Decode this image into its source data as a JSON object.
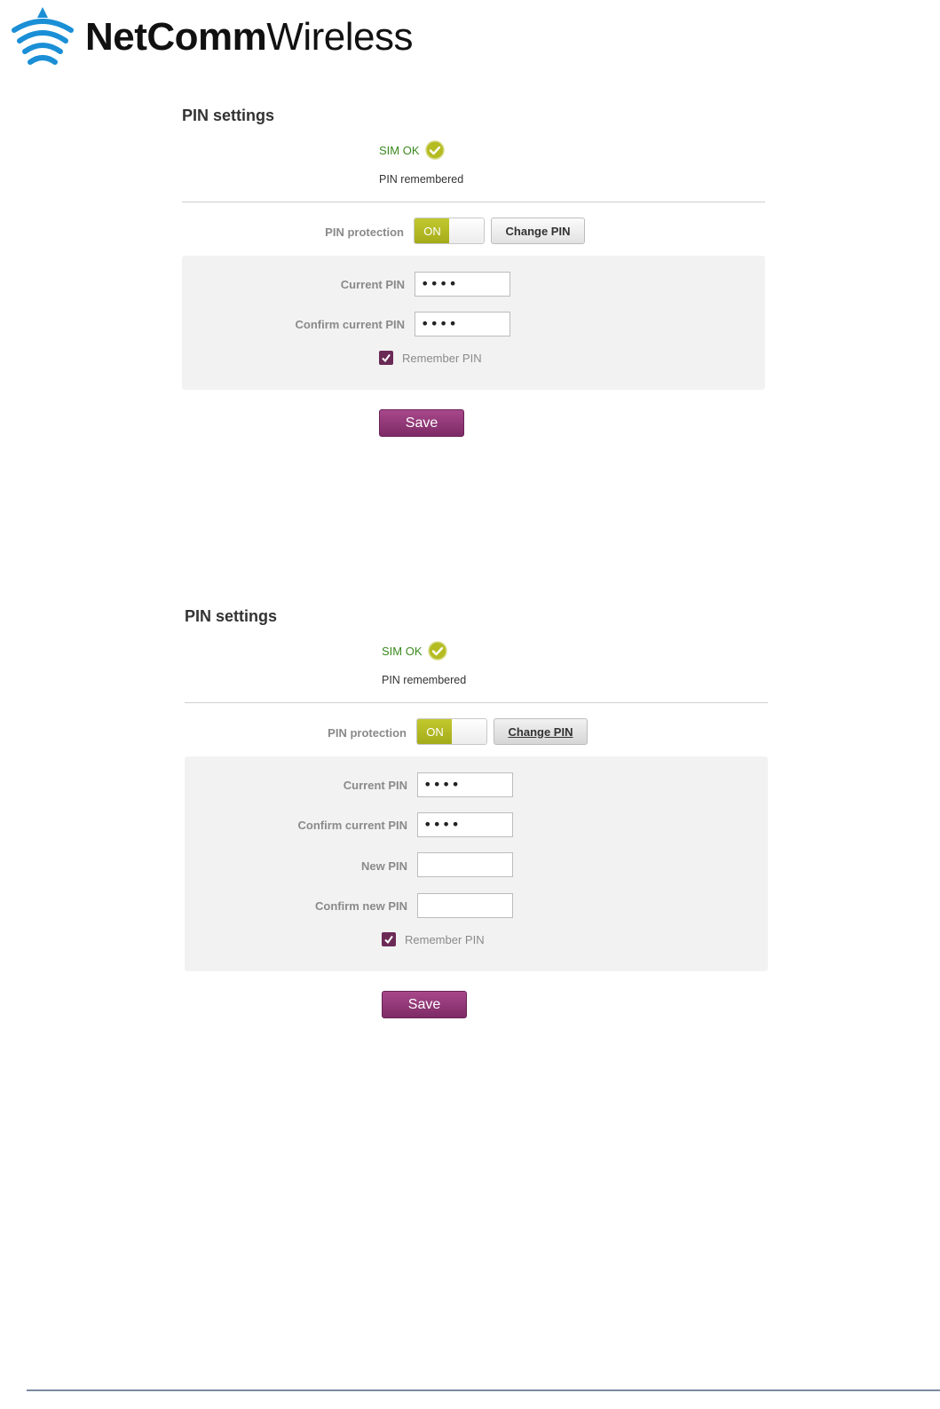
{
  "brand": {
    "name_bold": "NetComm",
    "name_light": "Wireless",
    "logo_icon": "wifi-antenna-icon",
    "color": "#1a8fd6"
  },
  "panels": [
    {
      "title": "PIN settings",
      "sim_status": "SIM OK",
      "sim_status_icon": "check-circle-icon",
      "pin_status": "PIN remembered",
      "pin_protection_label": "PIN protection",
      "toggle_label": "ON",
      "change_pin_label": "Change PIN",
      "fields": [
        {
          "label": "Current PIN",
          "value": "••••"
        },
        {
          "label": "Confirm current PIN",
          "value": "••••"
        }
      ],
      "remember_label": "Remember PIN",
      "remember_checked": true,
      "save_label": "Save"
    },
    {
      "title": "PIN settings",
      "sim_status": "SIM OK",
      "sim_status_icon": "check-circle-icon",
      "pin_status": "PIN remembered",
      "pin_protection_label": "PIN protection",
      "toggle_label": "ON",
      "change_pin_label": "Change PIN",
      "fields": [
        {
          "label": "Current PIN",
          "value": "••••"
        },
        {
          "label": "Confirm current PIN",
          "value": "••••"
        },
        {
          "label": "New PIN",
          "value": ""
        },
        {
          "label": "Confirm new PIN",
          "value": ""
        }
      ],
      "remember_label": "Remember PIN",
      "remember_checked": true,
      "save_label": "Save"
    }
  ],
  "colors": {
    "toggle_on": "#b5bc22",
    "save_button": "#8e3574",
    "sim_ok": "#3a8a1e",
    "checkbox": "#6b2a56"
  }
}
